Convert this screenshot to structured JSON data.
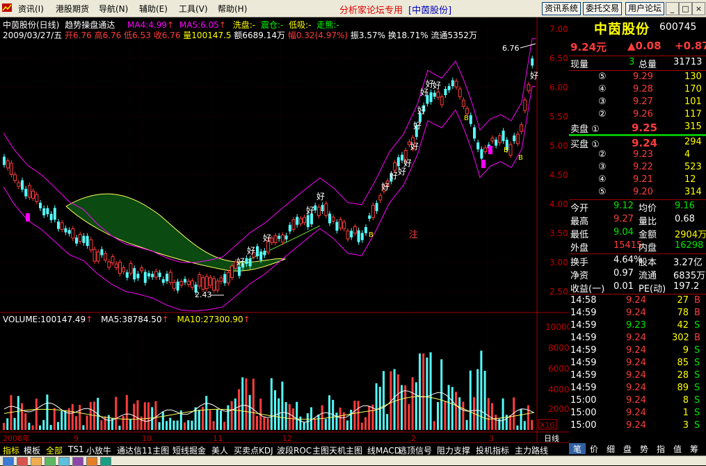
{
  "menu": {
    "items": [
      "资讯(I)",
      "港股期货",
      "导航(N)",
      "辅助(E)",
      "工具(V)",
      "帮助(H)"
    ],
    "forum_title": "分析家论坛专用",
    "stock_title": "[中茵股份]",
    "buttons": [
      "资讯系统",
      "委托交易",
      "用户论坛"
    ],
    "window_controls": [
      "_",
      "□",
      "×"
    ]
  },
  "chart": {
    "title": "中茵股份(日线)",
    "indicator": "趋势操盘通达",
    "ma4": "MA4:4.99",
    "ma5": "MA5:6.05",
    "flags": [
      "洗盘:-",
      "震仓:-",
      "低吸:-",
      "走熊:-"
    ],
    "date": "2009/03/27/五",
    "open": "开6.76",
    "high": "高6.76",
    "low": "低6.53",
    "close": "收6.76",
    "volume": "量100147.5",
    "amount": "额6689.14万",
    "change": "幅0.32(4.97%)",
    "amplitude": "振3.57%",
    "turnover": "换18.71%",
    "float": "流通5352万",
    "marker_high": "6.76",
    "marker_low": "2.43",
    "signal_good": "好",
    "signal_buy": "B",
    "signal_note": "注",
    "price_ticks": [
      "7.00",
      "6.50",
      "6.00",
      "5.50",
      "5.00",
      "4.50",
      "4.00",
      "3.50",
      "3.00",
      "2.50"
    ],
    "volume_label": "VOLUME:100147.49",
    "vol_ma5": "MA5:38784.50",
    "vol_ma10": "MA10:27300.90",
    "volume_ticks": [
      "10000",
      "8000",
      "6000",
      "4000",
      "2000"
    ],
    "volume_unit": "X10",
    "time_labels": [
      "2008年",
      "9",
      "10",
      "11",
      "12",
      "2",
      "3"
    ],
    "period_label": "日线"
  },
  "quote": {
    "name": "中茵股份",
    "code": "600745",
    "price": "9.24元",
    "change": "▲0.08",
    "change_pct": "+0.87",
    "xianliang_label": "现量",
    "xianliang": "3",
    "zongliang_label": "总量",
    "zongliang": "31713",
    "asks": [
      {
        "label": "⑤",
        "price": "9.29",
        "vol": "130"
      },
      {
        "label": "④",
        "price": "9.28",
        "vol": "170"
      },
      {
        "label": "③",
        "price": "9.27",
        "vol": "101"
      },
      {
        "label": "②",
        "price": "9.26",
        "vol": "117"
      },
      {
        "label": "卖盘 ①",
        "price": "9.25",
        "vol": "315"
      }
    ],
    "bids": [
      {
        "label": "买盘 ①",
        "price": "9.24",
        "vol": "294"
      },
      {
        "label": "②",
        "price": "9.23",
        "vol": "4"
      },
      {
        "label": "③",
        "price": "9.22",
        "vol": "523"
      },
      {
        "label": "④",
        "price": "9.21",
        "vol": "12"
      },
      {
        "label": "⑤",
        "price": "9.20",
        "vol": "314"
      }
    ],
    "stats": [
      {
        "l1": "今开",
        "v1": "9.12",
        "c1": "green",
        "l2": "均价",
        "v2": "9.16",
        "c2": "green"
      },
      {
        "l1": "最高",
        "v1": "9.27",
        "c1": "red",
        "l2": "量比",
        "v2": "0.68",
        "c2": "white"
      },
      {
        "l1": "最低",
        "v1": "9.04",
        "c1": "green",
        "l2": "金额",
        "v2": "2904万",
        "c2": "yellow"
      },
      {
        "l1": "外盘",
        "v1": "15415",
        "c1": "red",
        "l2": "内盘",
        "v2": "16298",
        "c2": "green"
      }
    ],
    "stats2": [
      {
        "l1": "换手",
        "v1": "4.64%",
        "l2": "股本",
        "v2": "3.27亿"
      },
      {
        "l1": "净资",
        "v1": "0.97",
        "l2": "流通",
        "v2": "6835万"
      },
      {
        "l1": "收益(一)",
        "v1": "0.01",
        "l2": "PE(动)",
        "v2": "197.2"
      }
    ],
    "ticks": [
      {
        "time": "14:58",
        "price": "9.24",
        "vol": "27",
        "side": "B"
      },
      {
        "time": "14:59",
        "price": "9.24",
        "vol": "78",
        "side": "B"
      },
      {
        "time": "14:59",
        "price": "9.23",
        "vol": "42",
        "side": "S"
      },
      {
        "time": "14:59",
        "price": "9.24",
        "vol": "302",
        "side": "B"
      },
      {
        "time": "14:59",
        "price": "9.24",
        "vol": "9",
        "side": "S"
      },
      {
        "time": "14:59",
        "price": "9.24",
        "vol": "85",
        "side": "S"
      },
      {
        "time": "14:59",
        "price": "9.24",
        "vol": "28",
        "side": "S"
      },
      {
        "time": "14:59",
        "price": "9.24",
        "vol": "89",
        "side": "S"
      },
      {
        "time": "15:00",
        "price": "9.24",
        "vol": "8",
        "side": "S"
      },
      {
        "time": "15:00",
        "price": "9.24",
        "vol": "1",
        "side": "S"
      },
      {
        "time": "15:00",
        "price": "9.24",
        "vol": "3",
        "side": "S"
      }
    ]
  },
  "bottom_tabs": [
    "指标",
    "模板",
    "全部",
    "TS1",
    "小放牛",
    "通达信11主图",
    "短线掘金",
    "美人",
    "买卖点KDJ",
    "波段ROC",
    "主图天机主图",
    "线MACD",
    "逃顶信号",
    "阻力支撑",
    "投机指标",
    "主力路线"
  ],
  "panel_tabs": [
    "笔",
    "价",
    "细",
    "盘",
    "势",
    "指",
    "值",
    "筹"
  ],
  "colors": {
    "up": "#ff3c3c",
    "down": "#54fcfc",
    "bg": "#000000",
    "grid": "#a00000",
    "ma_yellow": "#ffff66",
    "band_magenta": "#ff00ff",
    "fill_green": "#0b4a10"
  }
}
